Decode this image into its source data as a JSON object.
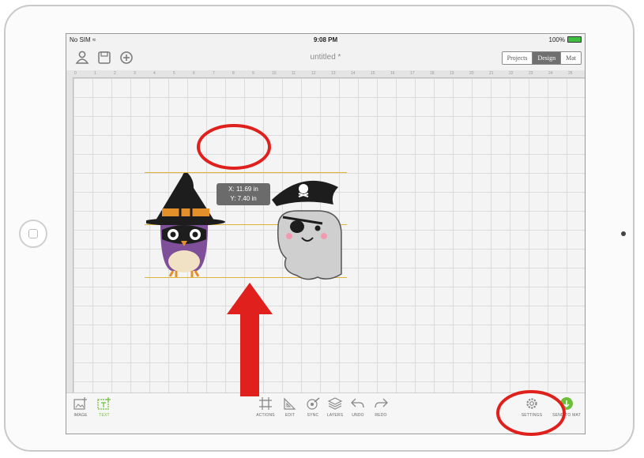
{
  "status_bar": {
    "carrier": "No SIM",
    "time": "9:08 PM",
    "battery": "100%",
    "battery_level": 1.0
  },
  "toolbar": {
    "doc_title": "untitled *",
    "segments": [
      {
        "label": "Projects",
        "active": false
      },
      {
        "label": "Design",
        "active": true
      },
      {
        "label": "Mat",
        "active": false
      }
    ],
    "icons": [
      "profile-icon",
      "save-icon",
      "new-project-icon"
    ]
  },
  "ruler": {
    "top_ticks": [
      "0",
      "1",
      "2",
      "3",
      "4",
      "5",
      "6",
      "7",
      "8",
      "9",
      "10",
      "11",
      "12",
      "13",
      "14",
      "15",
      "16",
      "17",
      "18",
      "19",
      "20",
      "21",
      "22",
      "23",
      "24",
      "25"
    ]
  },
  "tooltip": {
    "x_text": "X: 11.69 in",
    "y_text": "Y: 7.40 in"
  },
  "bottom_bar": {
    "left": [
      {
        "label": "IMAGE",
        "icon": "add-image-icon"
      },
      {
        "label": "TEXT",
        "icon": "add-text-icon"
      }
    ],
    "center": [
      {
        "label": "ACTIONS",
        "icon": "actions-icon"
      },
      {
        "label": "EDIT",
        "icon": "edit-icon"
      },
      {
        "label": "SYNC",
        "icon": "sync-icon"
      },
      {
        "label": "LAYERS",
        "icon": "layers-icon"
      },
      {
        "label": "UNDO",
        "icon": "undo-icon"
      },
      {
        "label": "REDO",
        "icon": "redo-icon"
      }
    ],
    "right": [
      {
        "label": "SETTINGS",
        "icon": "gear-icon"
      },
      {
        "label": "SEND TO MAT",
        "icon": "send-to-mat-icon"
      }
    ]
  },
  "colors": {
    "accent_green": "#6dbf3b",
    "guide_line": "#e0b33a",
    "annotation_red": "#e0201c",
    "active_segment": "#6f6f6f"
  }
}
